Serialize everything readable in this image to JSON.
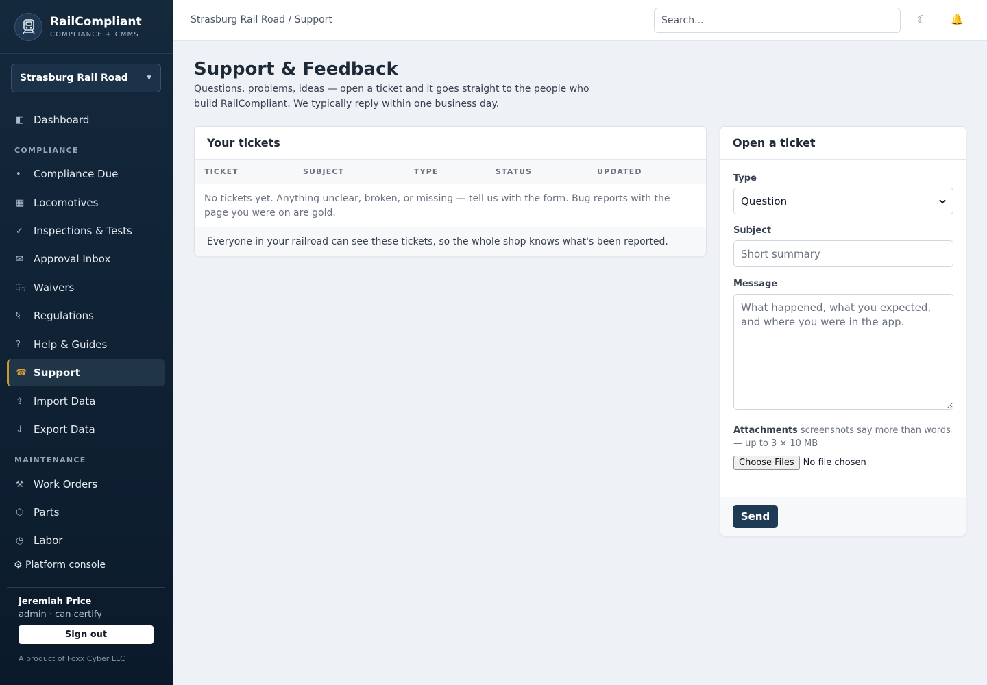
{
  "brand": {
    "name": "RailCompliant",
    "tagline": "COMPLIANCE + CMMS"
  },
  "railroad_select": {
    "value": "Strasburg Rail Road"
  },
  "nav": {
    "dashboard": "Dashboard",
    "compliance_label": "COMPLIANCE",
    "compliance_due": "Compliance Due",
    "locomotives": "Locomotives",
    "inspections": "Inspections & Tests",
    "approval_inbox": "Approval Inbox",
    "waivers": "Waivers",
    "regulations": "Regulations",
    "help": "Help & Guides",
    "support": "Support",
    "import": "Import Data",
    "export": "Export Data",
    "maintenance_label": "MAINTENANCE",
    "work_orders": "Work Orders",
    "parts": "Parts",
    "labor": "Labor",
    "platform_console": "⚙ Platform console"
  },
  "icons": {
    "dashboard": "◧",
    "compliance_due": "•",
    "locomotives": "▦",
    "inspections": "✓",
    "approval_inbox": "✉",
    "waivers": "⿻",
    "regulations": "§",
    "help": "?",
    "support": "☎",
    "import": "⇪",
    "export": "⇓",
    "work_orders": "⚒",
    "parts": "⬡",
    "labor": "◷",
    "theme": "☾",
    "bell": "🔔"
  },
  "user": {
    "name": "Jeremiah Price",
    "role": "admin · can certify",
    "sign_out": "Sign out",
    "product_of": "A product of Foxx Cyber LLC"
  },
  "topbar": {
    "breadcrumb": "Strasburg Rail Road / Support",
    "search_placeholder": "Search..."
  },
  "page": {
    "title": "Support & Feedback",
    "description": "Questions, problems, ideas — open a ticket and it goes straight to the people who build RailCompliant. We typically reply within one business day."
  },
  "tickets": {
    "title": "Your tickets",
    "columns": [
      "TICKET",
      "SUBJECT",
      "TYPE",
      "STATUS",
      "UPDATED"
    ],
    "empty": "No tickets yet. Anything unclear, broken, or missing — tell us with the form. Bug reports with the page you were on are gold.",
    "note": "Everyone in your railroad can see these tickets, so the whole shop knows what's been reported."
  },
  "form": {
    "title": "Open a ticket",
    "type_label": "Type",
    "type_value": "Question",
    "subject_label": "Subject",
    "subject_placeholder": "Short summary",
    "message_label": "Message",
    "message_placeholder": "What happened, what you expected, and where you were in the app.",
    "attachments_label": "Attachments",
    "attachments_hint": " screenshots say more than words — up to 3 × 10 MB",
    "choose_files": "Choose Files",
    "no_file": "No file chosen",
    "send": "Send"
  }
}
